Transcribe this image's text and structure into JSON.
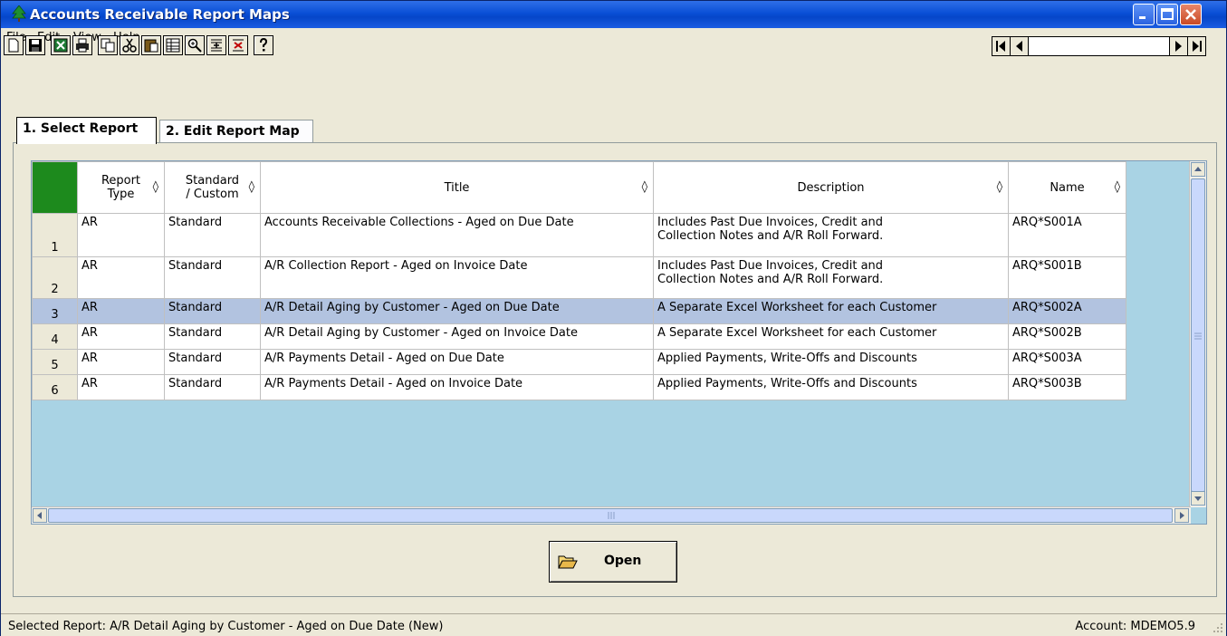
{
  "window": {
    "title": "Accounts Receivable Report Maps"
  },
  "menu": [
    "File",
    "Edit",
    "View",
    "Help"
  ],
  "tabs": [
    {
      "label": "1. Select Report"
    },
    {
      "label": "2. Edit Report Map"
    }
  ],
  "grid": {
    "columns": [
      "Report Type",
      "Standard / Custom",
      "Title",
      "Description",
      "Name"
    ],
    "header_lines": {
      "report_type": [
        "Report",
        "Type"
      ],
      "std_custom": [
        "Standard",
        "/ Custom"
      ]
    },
    "sort_glyph": "◊",
    "selected_row": 3,
    "rows": [
      {
        "num": "1",
        "type": "AR",
        "std": "Standard",
        "title": "Accounts Receivable Collections - Aged on Due Date",
        "desc1": "Includes Past Due Invoices, Credit and",
        "desc2": "Collection Notes and A/R Roll Forward.",
        "name": "ARQ*S001A"
      },
      {
        "num": "2",
        "type": "AR",
        "std": "Standard",
        "title": "A/R Collection Report - Aged on Invoice Date",
        "desc1": "Includes Past Due Invoices, Credit and",
        "desc2": "Collection Notes and A/R Roll Forward.",
        "name": "ARQ*S001B"
      },
      {
        "num": "3",
        "type": "AR",
        "std": "Standard",
        "title": "A/R Detail Aging by Customer - Aged on Due Date",
        "desc1": "A Separate Excel Worksheet for each Customer",
        "desc2": "",
        "name": "ARQ*S002A"
      },
      {
        "num": "4",
        "type": "AR",
        "std": "Standard",
        "title": "A/R Detail Aging by Customer - Aged on Invoice Date",
        "desc1": "A Separate Excel Worksheet for each Customer",
        "desc2": "",
        "name": "ARQ*S002B"
      },
      {
        "num": "5",
        "type": "AR",
        "std": "Standard",
        "title": "A/R Payments Detail - Aged on Due Date",
        "desc1": "Applied Payments, Write-Offs and Discounts",
        "desc2": "",
        "name": "ARQ*S003A"
      },
      {
        "num": "6",
        "type": "AR",
        "std": "Standard",
        "title": "A/R Payments Detail - Aged on Invoice Date",
        "desc1": "Applied Payments, Write-Offs and Discounts",
        "desc2": "",
        "name": "ARQ*S003B"
      }
    ]
  },
  "open_button": {
    "label": "Open"
  },
  "status": {
    "selected": "Selected Report: A/R Detail Aging by Customer - Aged on Due Date (New)",
    "account": "Account: MDEMO5.9"
  },
  "colors": {
    "titlebar": "#0a4fd6",
    "grid_bg": "#a9d3e4",
    "selected_row": "#b2c3e0",
    "corner": "#1d8a1d"
  }
}
